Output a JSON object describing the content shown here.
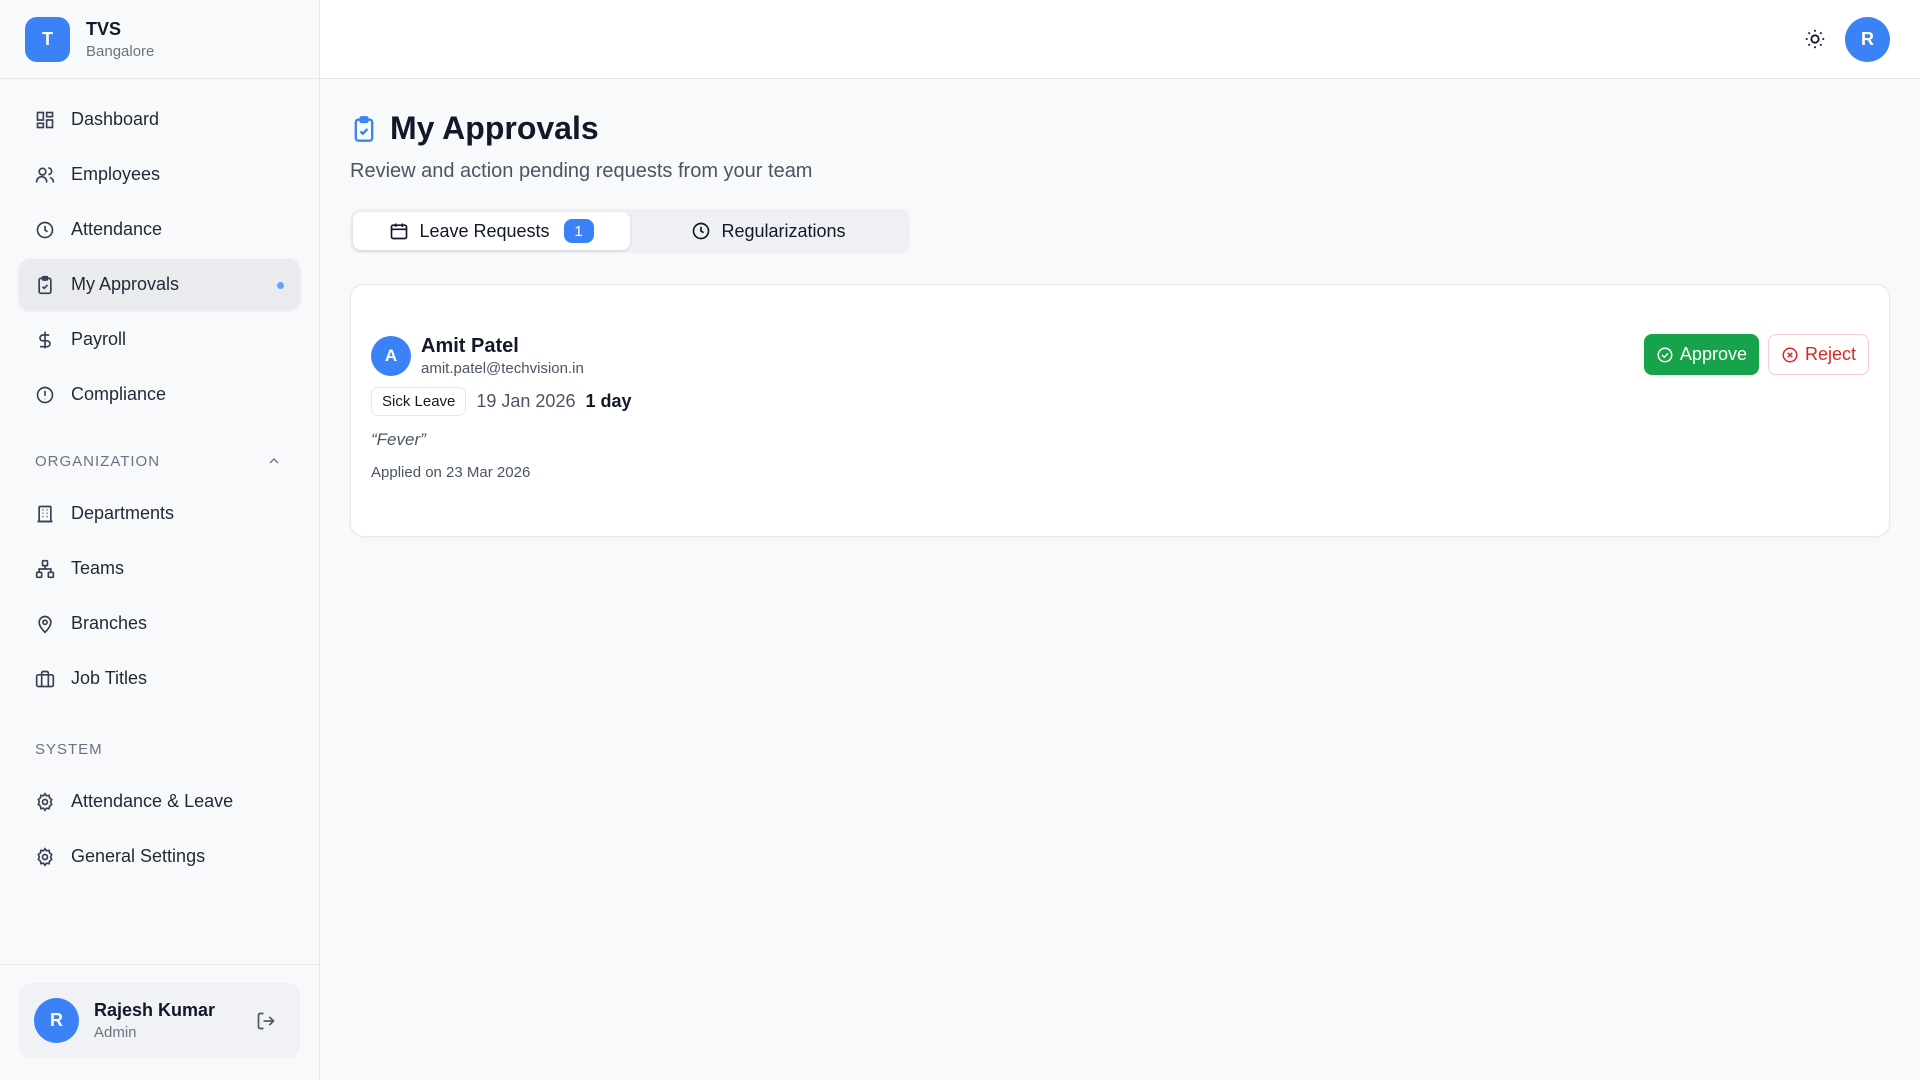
{
  "brand": {
    "initial": "T",
    "name": "TVS",
    "location": "Bangalore"
  },
  "nav": {
    "main": [
      {
        "label": "Dashboard",
        "icon": "dashboard-icon"
      },
      {
        "label": "Employees",
        "icon": "users-icon"
      },
      {
        "label": "Attendance",
        "icon": "clock-icon"
      },
      {
        "label": "My Approvals",
        "icon": "clipboard-check-icon",
        "active": true,
        "dot": true
      },
      {
        "label": "Payroll",
        "icon": "dollar-icon"
      },
      {
        "label": "Compliance",
        "icon": "alert-circle-icon"
      }
    ],
    "organization_label": "ORGANIZATION",
    "organization": [
      {
        "label": "Departments",
        "icon": "building-icon"
      },
      {
        "label": "Teams",
        "icon": "network-icon"
      },
      {
        "label": "Branches",
        "icon": "map-pin-icon"
      },
      {
        "label": "Job Titles",
        "icon": "briefcase-icon"
      }
    ],
    "system_label": "SYSTEM",
    "system": [
      {
        "label": "Attendance & Leave",
        "icon": "gear-icon"
      },
      {
        "label": "General Settings",
        "icon": "gear-icon"
      }
    ]
  },
  "user": {
    "initial": "R",
    "name": "Rajesh Kumar",
    "role": "Admin"
  },
  "header": {
    "avatar_initial": "R"
  },
  "page": {
    "title": "My Approvals",
    "subtitle": "Review and action pending requests from your team"
  },
  "tabs": {
    "leave": {
      "label": "Leave Requests",
      "count": "1"
    },
    "regularizations": {
      "label": "Regularizations"
    }
  },
  "request": {
    "initial": "A",
    "name": "Amit Patel",
    "email": "amit.patel@techvision.in",
    "leave_type": "Sick Leave",
    "date": "19 Jan 2026",
    "duration": "1 day",
    "reason": "“Fever”",
    "applied": "Applied on 23 Mar 2026",
    "approve_label": "Approve",
    "reject_label": "Reject"
  },
  "colors": {
    "accent": "#3b82f6",
    "approve": "#16a34a",
    "reject": "#dc2626"
  }
}
